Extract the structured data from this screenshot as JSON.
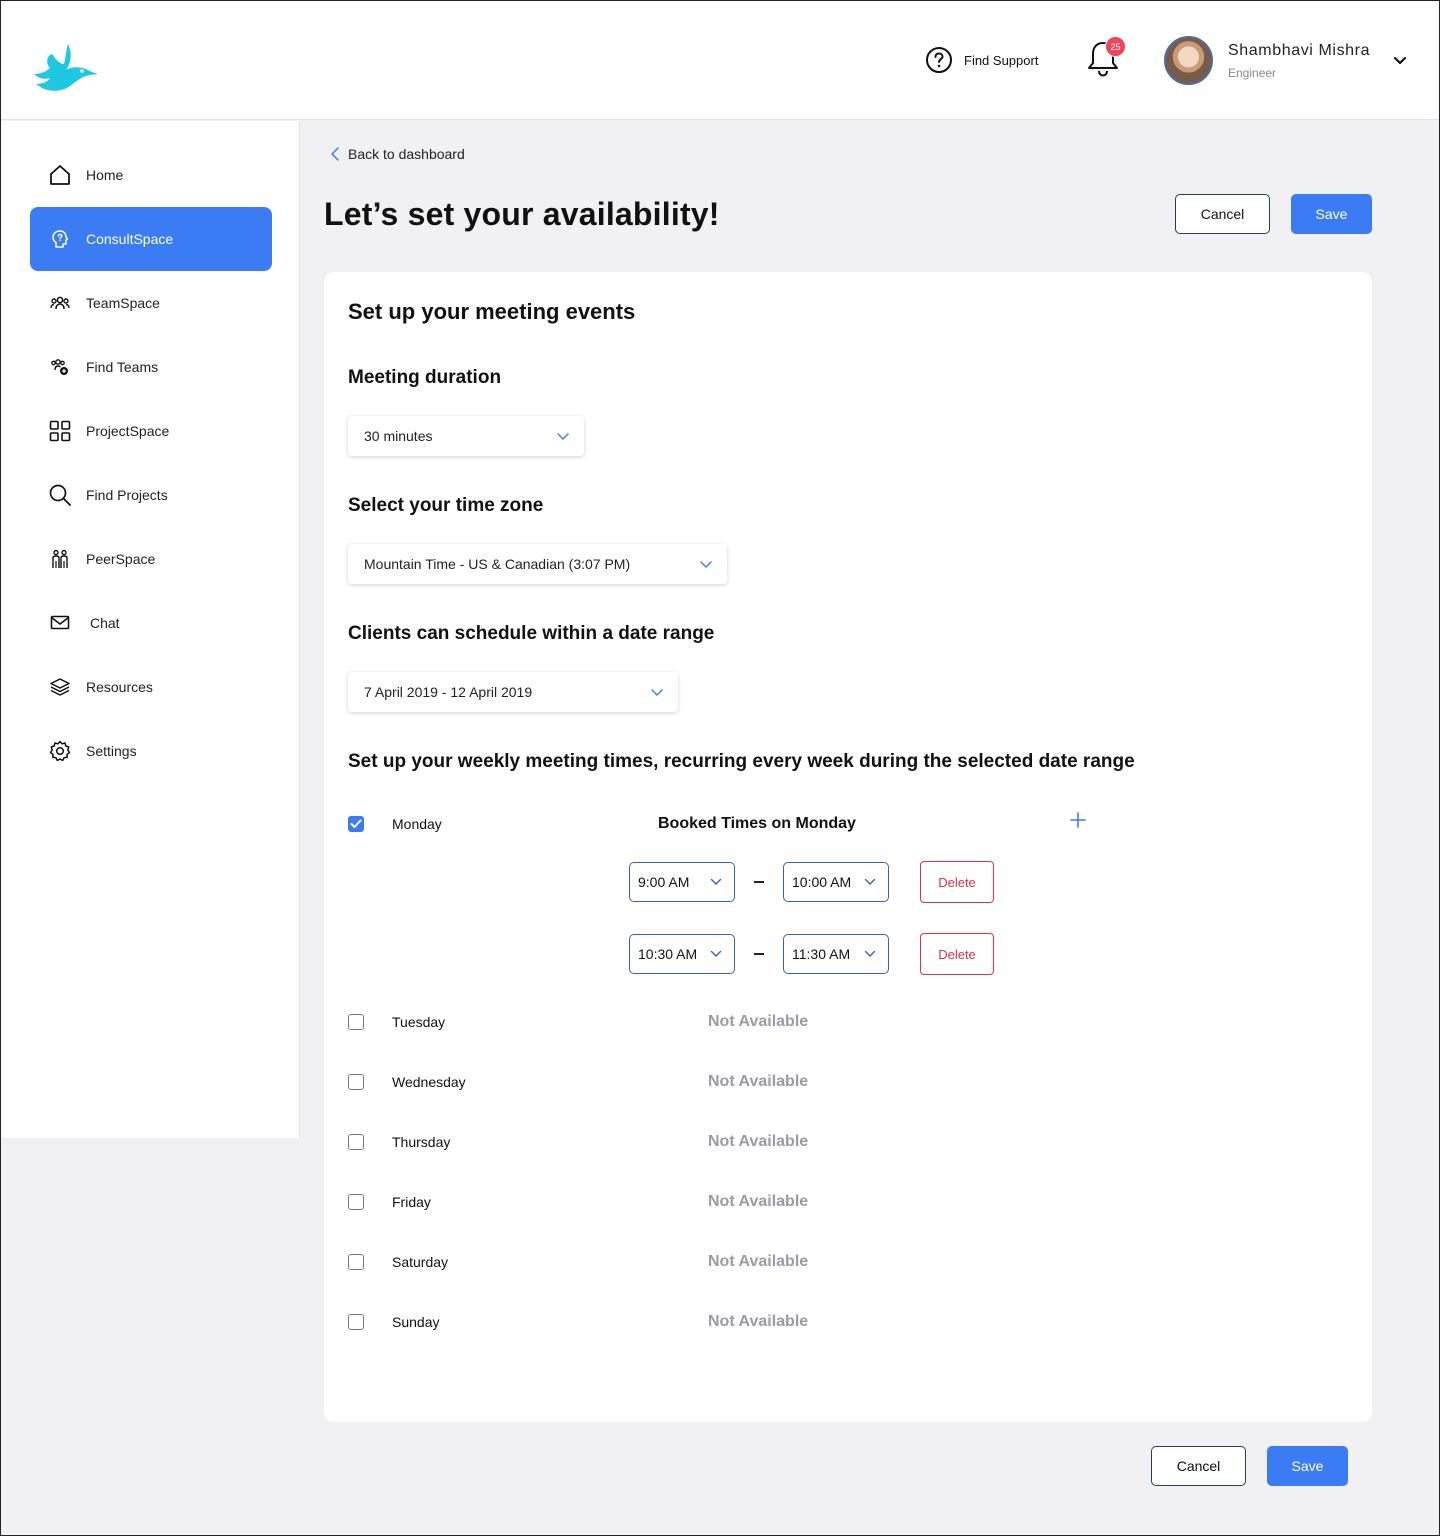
{
  "header": {
    "support_label": "Find Support",
    "notification_count": "25",
    "user_name": "Shambhavi Mishra",
    "user_role": "Engineer"
  },
  "sidebar": {
    "items": [
      {
        "label": "Home",
        "icon": "home-icon"
      },
      {
        "label": "ConsultSpace",
        "icon": "consult-icon",
        "active": true
      },
      {
        "label": "TeamSpace",
        "icon": "team-icon"
      },
      {
        "label": "Find Teams",
        "icon": "find-teams-icon"
      },
      {
        "label": "ProjectSpace",
        "icon": "grid-icon"
      },
      {
        "label": "Find Projects",
        "icon": "search-icon"
      },
      {
        "label": "PeerSpace",
        "icon": "peer-icon"
      },
      {
        "label": "Chat",
        "icon": "mail-icon"
      },
      {
        "label": "Resources",
        "icon": "layers-icon"
      },
      {
        "label": "Settings",
        "icon": "gear-icon"
      }
    ]
  },
  "page": {
    "back_label": "Back to dashboard",
    "title": "Let’s set your availability!",
    "cancel_label": "Cancel",
    "save_label": "Save"
  },
  "form": {
    "section_title": "Set up your meeting events",
    "duration_label": "Meeting duration",
    "duration_value": "30 minutes",
    "timezone_label": "Select your time zone",
    "timezone_value": "Mountain Time - US & Canadian (3:07 PM)",
    "range_label": "Clients can schedule within a date range",
    "range_value": "7 April 2019 - 12 April 2019",
    "weekly_label": "Set up your weekly meeting times, recurring every week during the selected date range"
  },
  "days": [
    {
      "name": "Monday",
      "checked": true
    },
    {
      "name": "Tuesday",
      "checked": false,
      "status": "Not Available"
    },
    {
      "name": "Wednesday",
      "checked": false,
      "status": "Not Available"
    },
    {
      "name": "Thursday",
      "checked": false,
      "status": "Not Available"
    },
    {
      "name": "Friday",
      "checked": false,
      "status": "Not Available"
    },
    {
      "name": "Saturday",
      "checked": false,
      "status": "Not Available"
    },
    {
      "name": "Sunday",
      "checked": false,
      "status": "Not Available"
    }
  ],
  "monday": {
    "booked_title": "Booked Times on Monday",
    "slots": [
      {
        "start": "9:00 AM",
        "end": "10:00 AM",
        "delete_label": "Delete"
      },
      {
        "start": "10:30 AM",
        "end": "11:30 AM",
        "delete_label": "Delete"
      }
    ]
  },
  "colors": {
    "accent": "#3b7cf5",
    "danger": "#e0333b",
    "muted": "#9a9aa8",
    "brand": "#1fc7e0"
  }
}
